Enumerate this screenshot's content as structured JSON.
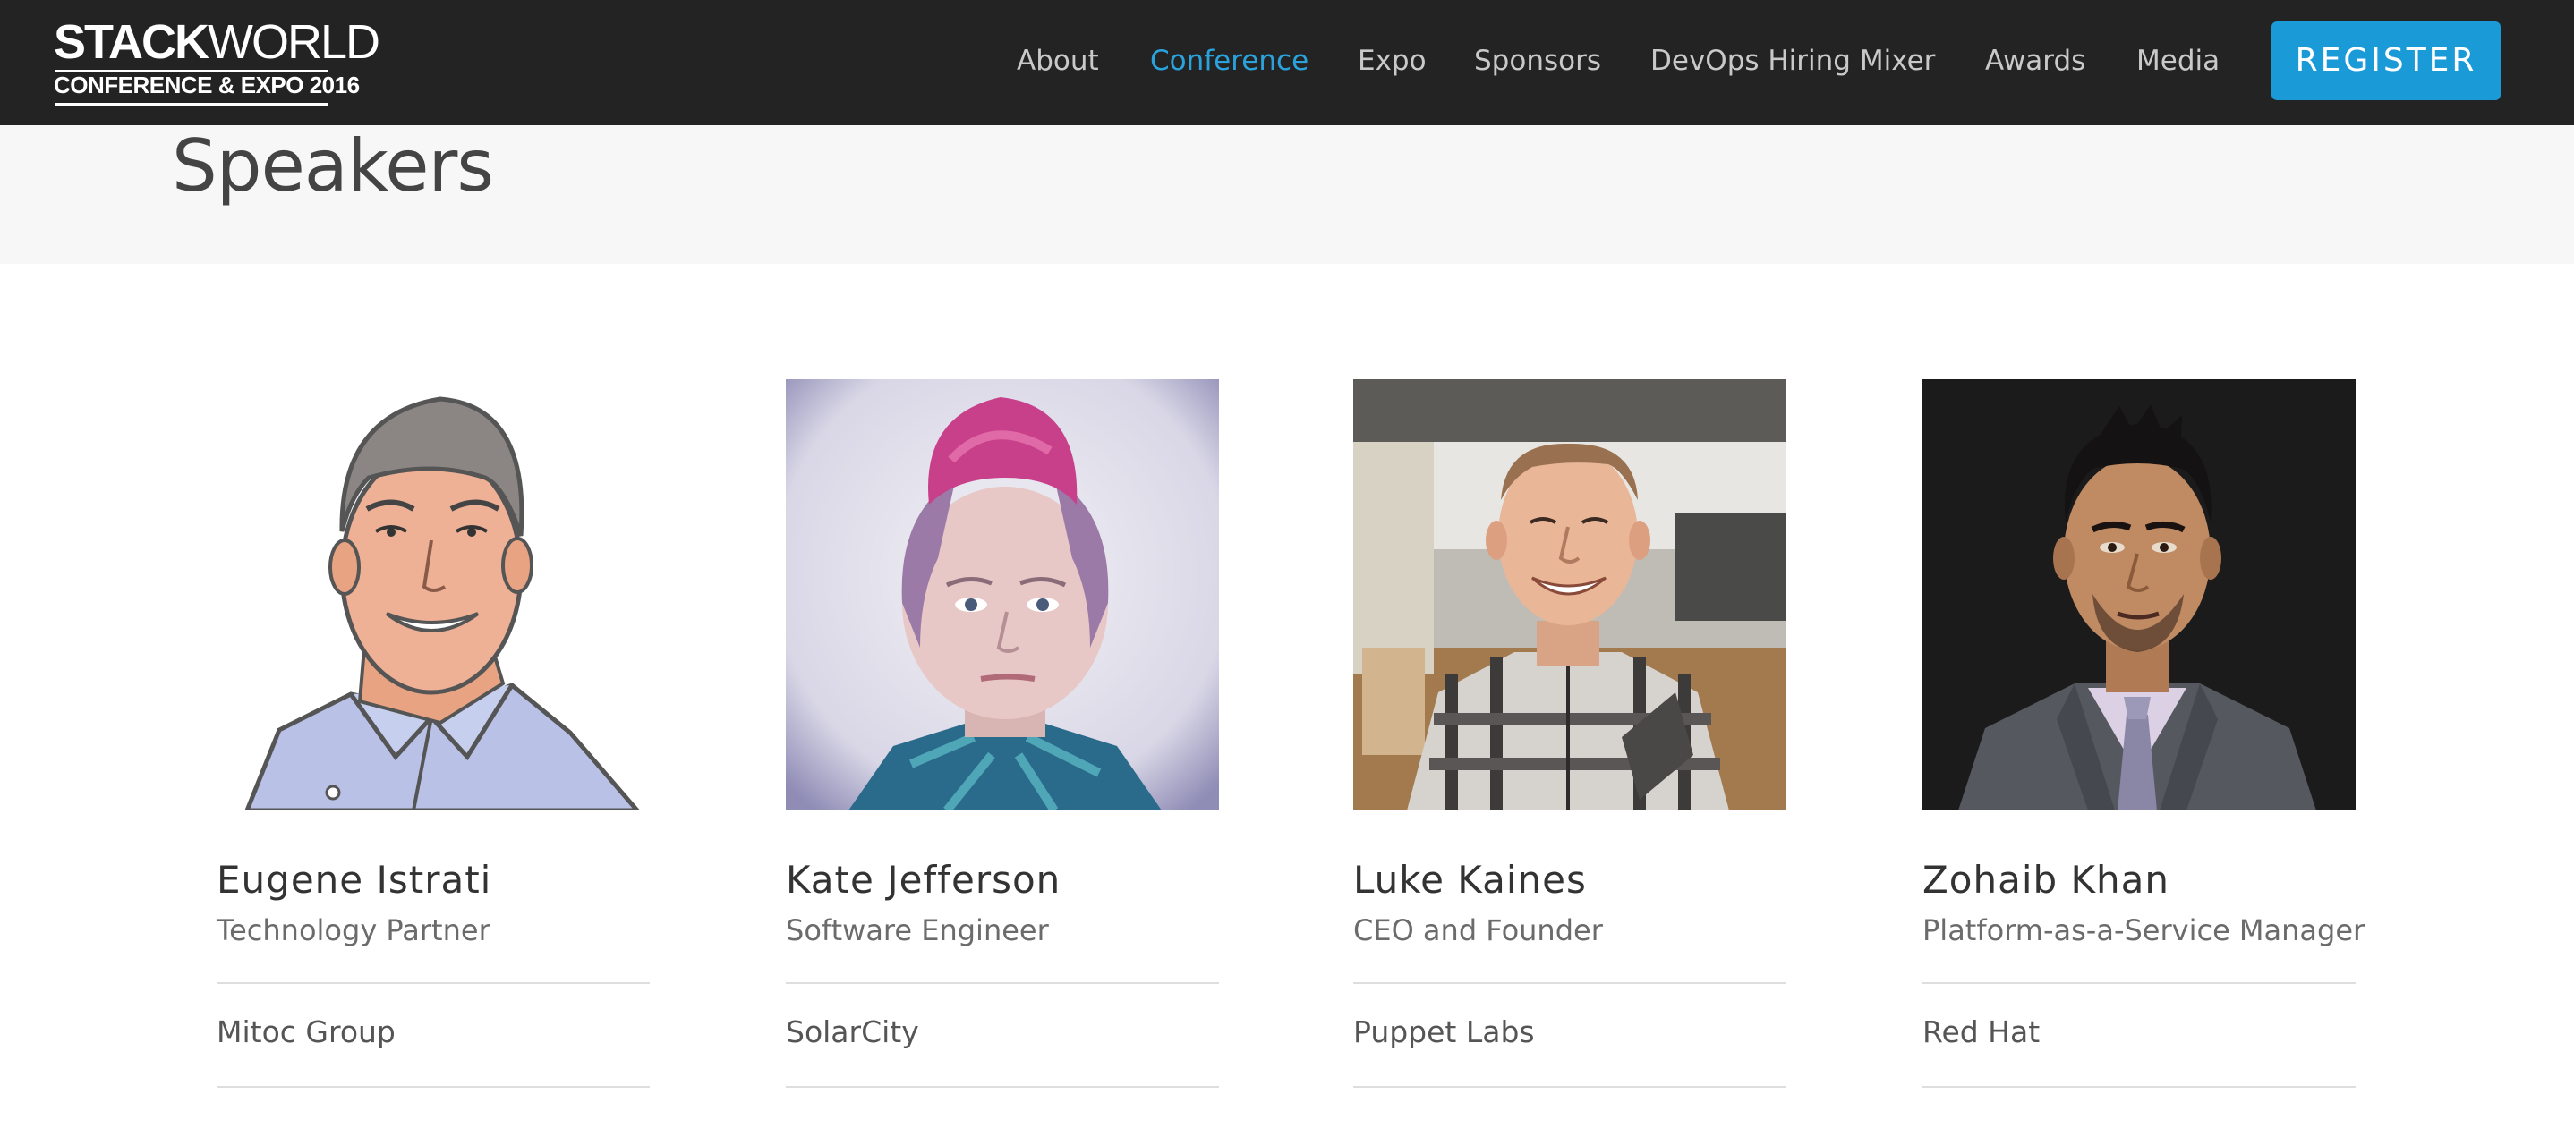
{
  "header": {
    "logo": {
      "line1_bold": "STACK",
      "line1_thin": "WORLD",
      "line2": "CONFERENCE & EXPO 2016"
    },
    "nav": [
      {
        "label": "About",
        "active": false
      },
      {
        "label": "Conference",
        "active": true
      },
      {
        "label": "Expo",
        "active": false
      },
      {
        "label": "Sponsors",
        "active": false
      },
      {
        "label": "DevOps Hiring Mixer",
        "active": false
      },
      {
        "label": "Awards",
        "active": false
      },
      {
        "label": "Media",
        "active": false
      }
    ],
    "register_label": "REGISTER"
  },
  "page": {
    "title": "Speakers"
  },
  "speakers": [
    {
      "name": "Eugene Istrati",
      "role": "Technology Partner",
      "company": "Mitoc Group"
    },
    {
      "name": "Kate Jefferson",
      "role": "Software Engineer",
      "company": "SolarCity"
    },
    {
      "name": "Luke Kaines",
      "role": "CEO and Founder",
      "company": "Puppet Labs"
    },
    {
      "name": "Zohaib Khan",
      "role": "Platform-as-a-Service Manager",
      "company": "Red Hat"
    }
  ],
  "colors": {
    "header_bg": "#232323",
    "accent": "#2aa2dc",
    "register_bg": "#1a9ad6",
    "band_bg": "#f7f7f7"
  }
}
